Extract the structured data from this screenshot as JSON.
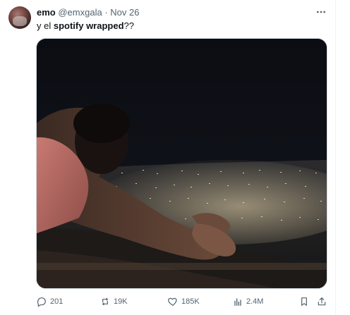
{
  "post": {
    "author_name": "emo",
    "author_handle": "@emxgala",
    "separator": "·",
    "date": "Nov 26",
    "text_prefix": "y el ",
    "text_bold": "spotify wrapped",
    "text_suffix": "??"
  },
  "actions": {
    "replies": "201",
    "reposts": "19K",
    "likes": "185K",
    "views": "2.4M"
  },
  "icons": {
    "more": "more-horizontal-icon",
    "reply": "reply-icon",
    "repost": "repost-icon",
    "like": "heart-icon",
    "views": "views-icon",
    "bookmark": "bookmark-icon",
    "share": "share-icon"
  },
  "colors": {
    "muted_text": "#536471",
    "primary_text": "#0f1419",
    "border": "#cfd9de"
  }
}
